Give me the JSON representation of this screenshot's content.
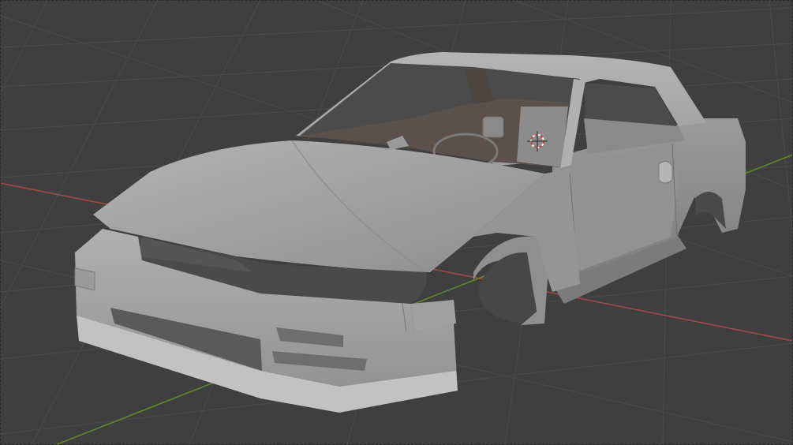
{
  "viewport": {
    "label": "",
    "background": "#3f3f3f",
    "grid_color": "#4c4c4c",
    "x_axis_color": "#b84a4a",
    "y_axis_color": "#6c9a2c",
    "model_color": "#a3a3a3",
    "interior_color": "#5a4e48",
    "cursor_color": "#d24040"
  },
  "scene": {
    "object": "car-body-mesh",
    "has_3d_cursor": true,
    "has_floor_grid": true
  }
}
